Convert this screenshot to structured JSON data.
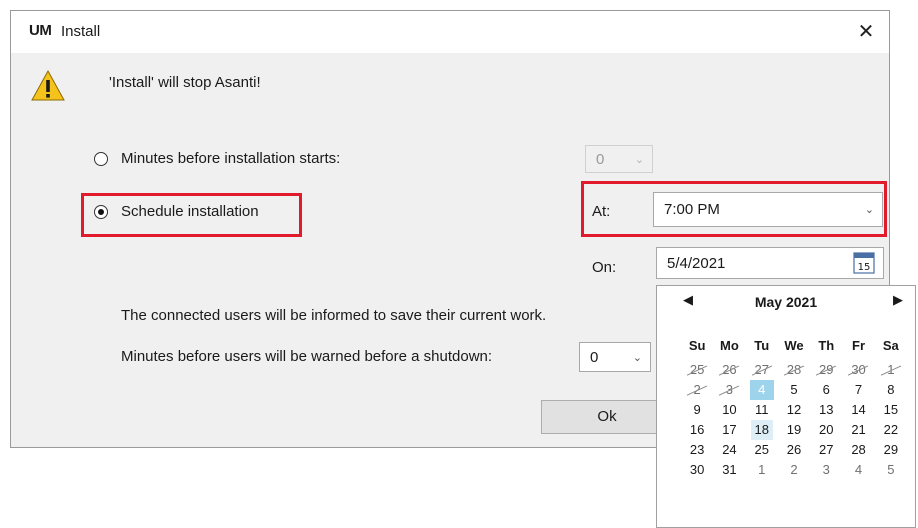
{
  "dialog": {
    "app_logo": "UM",
    "title": "Install",
    "close_glyph": "✕",
    "message": "'Install' will stop Asanti!",
    "option_minutes_label": "Minutes before installation starts:",
    "minutes_value": "0",
    "option_schedule_label": "Schedule installation",
    "at_label": "At:",
    "at_value": "7:00 PM",
    "on_label": "On:",
    "on_value": "5/4/2021",
    "calendar_icon_day": "15",
    "info_text": "The connected users will be informed to save their current work.",
    "warn_label": "Minutes before users will be warned before a shutdown:",
    "warn_value": "0",
    "ok_label": "Ok",
    "selected_option": "schedule"
  },
  "calendar": {
    "month_title": "May 2021",
    "prev_glyph": "◀",
    "next_glyph": "▶",
    "weekdays": [
      "Su",
      "Mo",
      "Tu",
      "We",
      "Th",
      "Fr",
      "Sa"
    ],
    "weeks": [
      [
        "25",
        "26",
        "27",
        "28",
        "29",
        "30",
        "1"
      ],
      [
        "2",
        "3",
        "4",
        "5",
        "6",
        "7",
        "8"
      ],
      [
        "9",
        "10",
        "11",
        "12",
        "13",
        "14",
        "15"
      ],
      [
        "16",
        "17",
        "18",
        "19",
        "20",
        "21",
        "22"
      ],
      [
        "23",
        "24",
        "25",
        "26",
        "27",
        "28",
        "29"
      ],
      [
        "30",
        "31",
        "1",
        "2",
        "3",
        "4",
        "5"
      ]
    ],
    "selected_day": "4",
    "today_day": "18"
  },
  "colors": {
    "highlight": "#e21b2c",
    "selected": "#9ed3ec",
    "today": "#ddeef7"
  }
}
